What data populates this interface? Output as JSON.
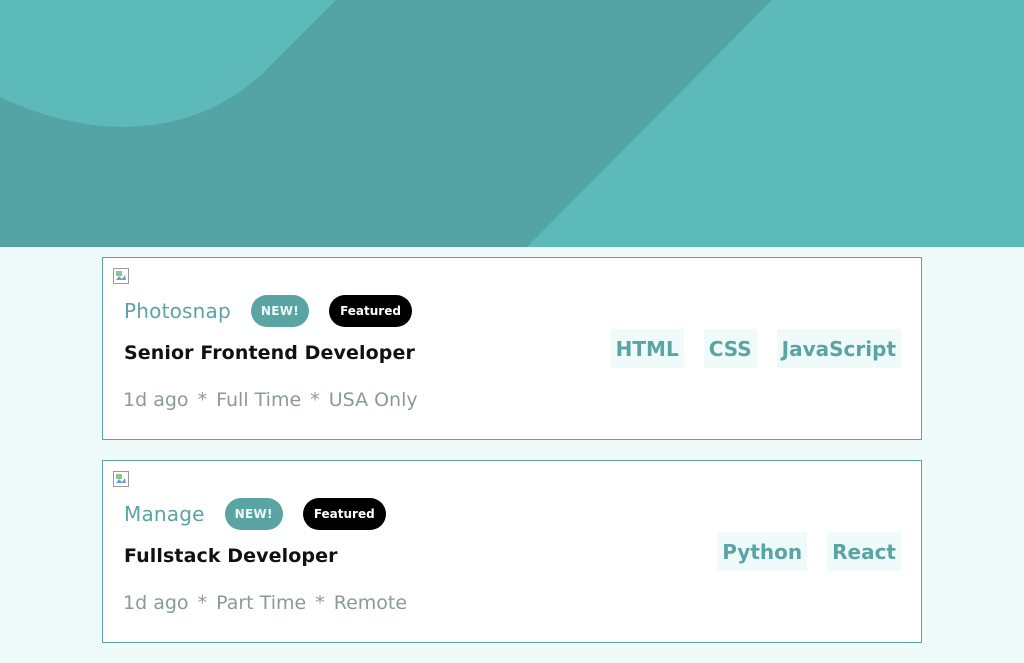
{
  "header": {
    "background_color": "#5cbab8",
    "shape_color": "#54a4a5",
    "shape_icon": "header-wave-pattern"
  },
  "jobs": [
    {
      "logo": "broken-image-icon",
      "company": "Photosnap",
      "new_label": "NEW!",
      "featured_label": "Featured",
      "position": "Senior Frontend Developer",
      "posted": "1d ago",
      "contract": "Full Time",
      "location": "USA Only",
      "separator": "*",
      "tags": [
        "HTML",
        "CSS",
        "JavaScript"
      ]
    },
    {
      "logo": "broken-image-icon",
      "company": "Manage",
      "new_label": "NEW!",
      "featured_label": "Featured",
      "position": "Fullstack Developer",
      "posted": "1d ago",
      "contract": "Part Time",
      "location": "Remote",
      "separator": "*",
      "tags": [
        "Python",
        "React"
      ]
    }
  ],
  "colors": {
    "accent": "#5ba4a4",
    "page_background": "#effafa",
    "tag_background": "#effafa",
    "featured_background": "#000000",
    "meta_text": "#8a9a9a"
  }
}
